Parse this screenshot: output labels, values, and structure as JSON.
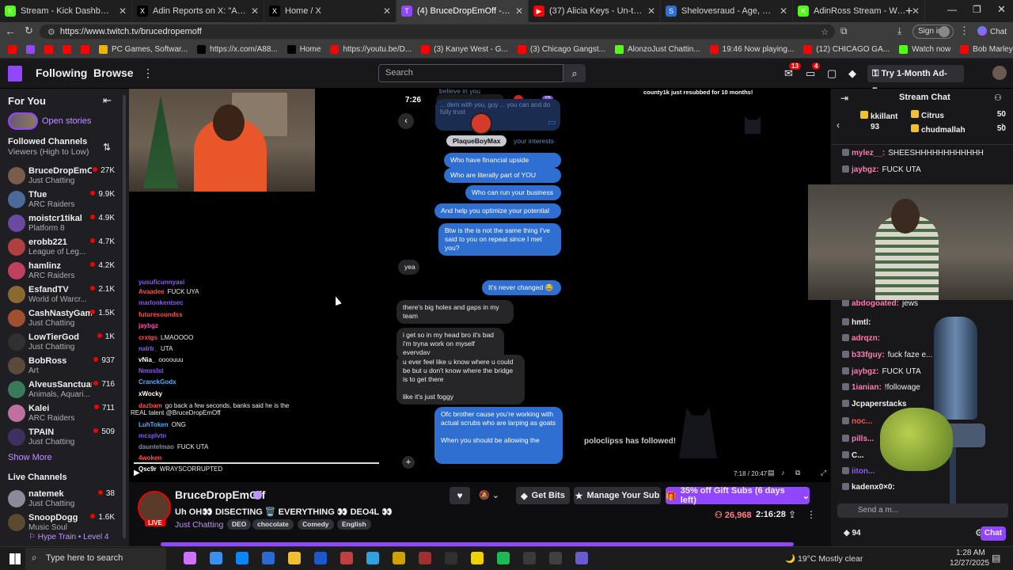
{
  "browser": {
    "tabs": [
      {
        "label": "Stream - Kick Dashboard",
        "favicon_color": "#53fc18",
        "favicon": "K"
      },
      {
        "label": "Adin Reports on X: \"Adin Ross cla",
        "favicon_color": "#000000",
        "favicon": "X"
      },
      {
        "label": "Home / X",
        "favicon_color": "#000000",
        "favicon": "X"
      },
      {
        "label": "(4) BruceDropEmOff - Twitch",
        "favicon_color": "#9147ff",
        "favicon": "T"
      },
      {
        "label": "(37) Alicia Keys - Un-thinkable (I'm",
        "favicon_color": "#ff0000",
        "favicon": "▶"
      },
      {
        "label": "Shelovesraud - Age, Bio, Family | F",
        "favicon_color": "#2f6fd1",
        "favicon": "S"
      },
      {
        "label": "AdinRoss Stream - Watch Live on",
        "favicon_color": "#53fc18",
        "favicon": "K"
      }
    ],
    "url": "https://www.twitch.tv/brucedropemoff",
    "sign_in": "Sign in",
    "chat_label": "Chat",
    "bookmarks": [
      {
        "label": "",
        "color": "#ff0000"
      },
      {
        "label": "",
        "color": "#9147ff"
      },
      {
        "label": "",
        "color": "#ff0000"
      },
      {
        "label": "",
        "color": "#ff0000"
      },
      {
        "label": "",
        "color": "#ff0000"
      },
      {
        "label": "PC Games, Softwar...",
        "color": "#f0b400"
      },
      {
        "label": "https://x.com/A88...",
        "color": "#000000"
      },
      {
        "label": "Home",
        "color": "#000000"
      },
      {
        "label": "https://youtu.be/D...",
        "color": "#ff0000"
      },
      {
        "label": "(3) Kanye West - G...",
        "color": "#ff0000"
      },
      {
        "label": "(3) Chicago Gangst...",
        "color": "#ff0000"
      },
      {
        "label": "AlonzoJust Chattin...",
        "color": "#53fc18"
      },
      {
        "label": "19:46 Now playing...",
        "color": "#ff0000"
      },
      {
        "label": "(12) CHICAGO GA...",
        "color": "#ff0000"
      },
      {
        "label": "Watch now",
        "color": "#53fc18"
      },
      {
        "label": "Bob Marley - Waiti...",
        "color": "#ff0000"
      }
    ]
  },
  "twitch": {
    "nav": {
      "following": "Following",
      "browse": "Browse",
      "search_placeholder": "Search",
      "notif_count": "13",
      "inbox_count": "4",
      "ad_free": "Try 1-Month Ad-Free"
    },
    "sidebar": {
      "for_you": "For You",
      "open_stories": "Open stories",
      "followed_title": "Followed Channels",
      "followed_sort": "Viewers (High to Low)",
      "channels": [
        {
          "name": "BruceDropEmOff",
          "game": "Just Chatting",
          "viewers": "27K",
          "color": "#7a5c4a"
        },
        {
          "name": "Tfue",
          "game": "ARC Raiders",
          "viewers": "9.9K",
          "color": "#4a6a9a"
        },
        {
          "name": "moistcr1tikal",
          "game": "Platform 8",
          "viewers": "4.9K",
          "color": "#6a4aa0"
        },
        {
          "name": "erobb221",
          "game": "League of Leg...",
          "viewers": "4.7K",
          "color": "#b04040"
        },
        {
          "name": "hamlinz",
          "game": "ARC Raiders",
          "viewers": "4.2K",
          "color": "#c04060"
        },
        {
          "name": "EsfandTV",
          "game": "World of Warcr...",
          "viewers": "2.1K",
          "color": "#8a6a30"
        },
        {
          "name": "CashNastyGam...",
          "game": "Just Chatting",
          "viewers": "1.5K",
          "color": "#a05030"
        },
        {
          "name": "LowTierGod",
          "game": "Just Chatting",
          "viewers": "1K",
          "color": "#303030"
        },
        {
          "name": "BobRoss",
          "game": "Art",
          "viewers": "937",
          "color": "#5a4a3a"
        },
        {
          "name": "AlveusSanctuary",
          "game": "Animals, Aquari...",
          "viewers": "716",
          "color": "#3a7a5a"
        },
        {
          "name": "Kalei",
          "game": "ARC Raiders",
          "viewers": "711",
          "color": "#c070a0"
        },
        {
          "name": "TPAIN",
          "game": "Just Chatting",
          "viewers": "509",
          "color": "#403060"
        }
      ],
      "show_more": "Show More",
      "live_title": "Live Channels",
      "live": [
        {
          "name": "natemek",
          "game": "Just Chatting",
          "viewers": "38",
          "color": "#8a8a9a"
        },
        {
          "name": "SnoopDogg",
          "game": "Music Soul",
          "viewers": "1.6K",
          "color": "#5a4a30"
        }
      ],
      "hype_train": "Hype Train • Level 4"
    },
    "video": {
      "phone_time": "7:26",
      "contact_name": "PlaqueBoyMax",
      "top_faded": "believe in you",
      "faded_block": "... dem with you, guy ... you can and do fully trust",
      "faded_interests": "your interests",
      "messages": [
        {
          "text": "Who have financial upside",
          "side": "out"
        },
        {
          "text": "Who are literally part of YOU",
          "side": "out"
        },
        {
          "text": "Who can run your business",
          "side": "out"
        },
        {
          "text": "And help you optimize your potential",
          "side": "out"
        },
        {
          "text": "Btw is the is not the same thing I've said to you on repeat since I met you?",
          "side": "out"
        },
        {
          "text": "yea",
          "side": "in"
        },
        {
          "text": "It's never changed 😂",
          "side": "out"
        },
        {
          "text": "there's big holes and gaps in my team",
          "side": "in"
        },
        {
          "text": "i get so in my head bro it's bad i'm tryna work on myself everyday",
          "side": "in"
        },
        {
          "text": "u ever feel like u know where u could be but u don't know where the bridge is to get there\n\nlike it's just foggy",
          "side": "in"
        },
        {
          "text": "Ofc brother cause you're working with actual scrubs who are larping as goats\n\nWhen you should be allowing the",
          "side": "out"
        }
      ],
      "resub": "county1k just resubbed for 10 months!",
      "follow_alert": "poloclipss has followed!",
      "overlay_chat": [
        {
          "user": "yusuficunnyasi",
          "msg": "",
          "color": "#8a5cf0"
        },
        {
          "user": "Avaadee",
          "msg": "FUCK UYA",
          "color": "#ff4f4f"
        },
        {
          "user": "marlonkentsec",
          "msg": "",
          "color": "#8a5cf0"
        },
        {
          "user": "futuresoundss",
          "msg": "",
          "color": "#ff4f4f"
        },
        {
          "user": "jaybgz",
          "msg": "",
          "color": "#ff4fb0"
        },
        {
          "user": "crxtgs",
          "msg": "LMAOOOO",
          "color": "#ff4f4f"
        },
        {
          "user": "nalrb_",
          "msg": "UTA",
          "color": "#8a5cf0"
        },
        {
          "user": "vNia_",
          "msg": "oooouuu",
          "color": "#ffffff"
        },
        {
          "user": "Nmoslst",
          "msg": "",
          "color": "#8a5cf0"
        },
        {
          "user": "CranckGodx",
          "msg": "",
          "color": "#4fb0ff"
        },
        {
          "user": "xWocky",
          "msg": "",
          "color": "#ffffff"
        },
        {
          "user": "dazbam",
          "msg": "go back a few seconds, banks said he is the REAL talent @BruceDropEmOff",
          "color": "#ff4f4f"
        },
        {
          "user": "LuhToken",
          "msg": "ONG",
          "color": "#4fb0ff"
        },
        {
          "user": "mcsplvtn",
          "msg": "",
          "color": "#8a5cf0"
        },
        {
          "user": "dauntelmao",
          "msg": "FUCK UTA",
          "color": "#8a8aa0"
        },
        {
          "user": "4woken",
          "msg": "",
          "color": "#ff4f4f"
        },
        {
          "user": "Qsc9r",
          "msg": "WRAYSCORRUPTED",
          "color": "#ffffff"
        }
      ],
      "time": "7:18 / 20:47"
    },
    "channel": {
      "name": "BruceDropEmOff",
      "title": "Uh OH👀 DISECTING 🗑️ EVERYTHING 👀 DEO4L 👀",
      "category": "Just Chatting",
      "tags": [
        "DEO",
        "chocolate",
        "Comedy",
        "English"
      ],
      "live_badge": "LIVE",
      "viewers": "26,968",
      "uptime": "2:16:28",
      "get_bits": "Get Bits",
      "manage_sub": "Manage Your Sub",
      "gift_subs": "35% off Gift Subs (6 days left)"
    },
    "chat": {
      "title": "Stream Chat",
      "gifters": [
        {
          "name": "kkillant",
          "count": "93"
        },
        {
          "name": "Citrus",
          "count": "50"
        },
        {
          "name": "chudmallah",
          "count": "50"
        }
      ],
      "messages": [
        {
          "user": "mylez__:",
          "msg": "SHEESHHHHHHHHHHHH",
          "color": "#ff7ab0"
        },
        {
          "user": "jaybgz:",
          "msg": "FUCK UTA",
          "color": "#ff7ab0"
        },
        {
          "user": "abdogoated:",
          "msg": "jews",
          "color": "#ff7ab0"
        },
        {
          "user": "hmtl:",
          "msg": "",
          "color": "#efeff1"
        },
        {
          "user": "adrqzn:",
          "msg": "",
          "color": "#ff7ab0"
        },
        {
          "user": "b33fguy:",
          "msg": "fuck faze e... ool",
          "color": "#ff7ab0"
        },
        {
          "user": "jaybgz:",
          "msg": "FUCK UTA",
          "color": "#ff7ab0"
        },
        {
          "user": "1ianian:",
          "msg": "!followage",
          "color": "#ff7ab0"
        },
        {
          "user": "Jcpaperstacks",
          "msg": "",
          "color": "#efeff1"
        },
        {
          "user": "noc...",
          "msg": "",
          "color": "#ff4f4f"
        },
        {
          "user": "pills...",
          "msg": "",
          "color": "#ff7ab0"
        },
        {
          "user": "C...",
          "msg": "",
          "color": "#efeff1"
        },
        {
          "user": "iiton...",
          "msg": "",
          "color": "#8a5cf0"
        },
        {
          "user": "kadenx0×0:",
          "msg": "",
          "color": "#efeff1"
        }
      ],
      "input_placeholder": "Send a m...",
      "points": "94",
      "send_label": "Chat"
    }
  },
  "taskbar": {
    "search_placeholder": "Type here to search",
    "weather": "19°C  Mostly clear",
    "time": "1:28 AM",
    "date": "12/27/2025"
  }
}
